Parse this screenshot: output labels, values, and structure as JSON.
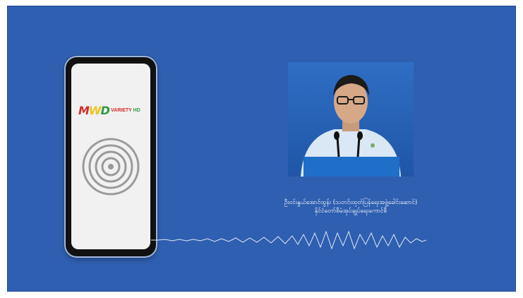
{
  "logo": {
    "m": "M",
    "w": "W",
    "d": "D",
    "sub": "VARIETY",
    "hd": "HD"
  },
  "caption": {
    "line1": "ဦးဝင်းနွယ်အောင်ထွန်း (သတင်းထုတ်ပြန်ရေးအဖွဲ့ခေါင်းဆောင်)",
    "line2": "နိုင်ငံတော်စီမံအုပ်ချုပ်ရေးကောင်စီ"
  },
  "colors": {
    "background": "#2f5fb1",
    "phone_screen": "#f1f1f1",
    "logo_red": "#d62b28",
    "logo_yellow": "#e8c51c",
    "logo_green": "#2e9a47"
  }
}
